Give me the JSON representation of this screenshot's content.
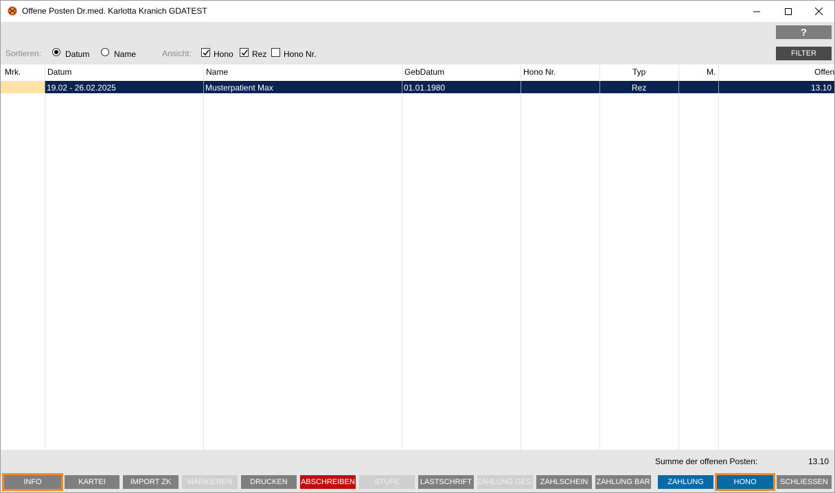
{
  "window": {
    "title": "Offene Posten Dr.med. Karlotta Kranich GDATEST",
    "icon": "app-logo-icon"
  },
  "toolbar": {
    "help_label": "?",
    "filter_label": "FILTER",
    "sort_label": "Sortieren:",
    "sort_options": [
      {
        "label": "Datum",
        "checked": true
      },
      {
        "label": "Name",
        "checked": false
      }
    ],
    "view_label": "Ansicht:",
    "view_options": [
      {
        "label": "Hono",
        "checked": true
      },
      {
        "label": "Rez",
        "checked": true
      },
      {
        "label": "Hono Nr.",
        "checked": false
      }
    ]
  },
  "table": {
    "columns": [
      "Mrk.",
      "Datum",
      "Name",
      "GebDatum",
      "Hono Nr.",
      "Typ",
      "M.",
      "Offen"
    ],
    "rows": [
      {
        "mrk": "",
        "datum": "19.02 - 26.02.2025",
        "name": "Musterpatient Max",
        "gebdatum": "01.01.1980",
        "hono_nr": "",
        "typ": "Rez",
        "m": "",
        "offen": "13.10"
      }
    ],
    "selected_row_color": "#0a2350",
    "mark_cell_color": "#ffe3a6"
  },
  "summary": {
    "label": "Summe der offenen Posten:",
    "value": "13.10"
  },
  "buttons": {
    "info": "INFO",
    "kartei": "KARTEI",
    "import_zk": "IMPORT ZK",
    "markieren": "MARKIEREN",
    "drucken": "DRUCKEN",
    "abschreiben": "ABSCHREIBEN",
    "stufe": "STUFE",
    "lastschrift": "LASTSCHRIFT",
    "zahlung_ges": "ZAHLUNG GES.",
    "zahlschein": "ZAHLSCHEIN",
    "zahlung_bar": "ZAHLUNG BAR",
    "zahlung": "ZAHLUNG",
    "hono": "HONO",
    "schliessen": "SCHLIESSEN"
  },
  "colors": {
    "accent_blue": "#0a6aa6",
    "danger_red": "#c00d0d",
    "focus_orange": "#f08a2a"
  }
}
